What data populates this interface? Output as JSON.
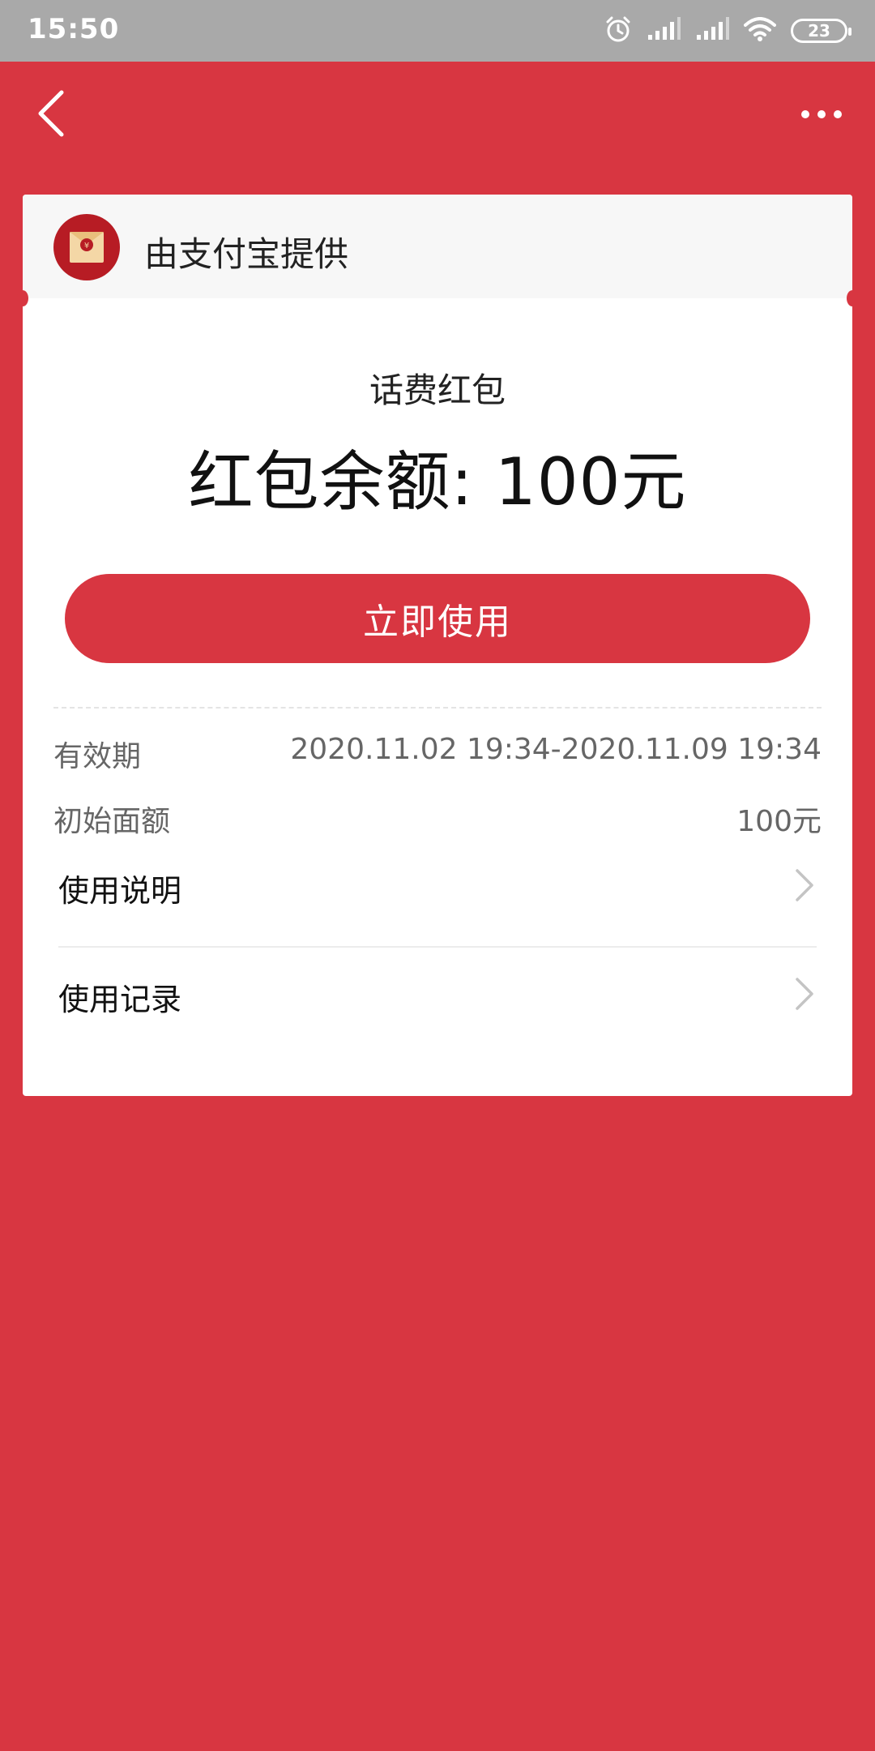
{
  "status_bar": {
    "time": "15:50",
    "battery": "23",
    "icons": [
      "alarm-icon",
      "signal-icon",
      "signal-icon",
      "wifi-icon",
      "battery-icon"
    ]
  },
  "nav": {
    "back_icon": "chevron-left-icon",
    "more_icon": "more-dots-icon"
  },
  "card": {
    "provider": "由支付宝提供",
    "provider_icon": "red-envelope-icon",
    "subtitle": "话费红包",
    "balance": "红包余额: 100元",
    "use_button": "立即使用",
    "validity_label": "有效期",
    "validity_value": "2020.11.02 19:34-2020.11.09 19:34",
    "initial_label": "初始面额",
    "initial_value": "100元",
    "menu": [
      {
        "label": "使用说明",
        "icon": "chevron-right-icon"
      },
      {
        "label": "使用记录",
        "icon": "chevron-right-icon"
      }
    ]
  },
  "colors": {
    "background": "#d83641",
    "status_bar": "#a9a9a9",
    "button": "#d83641",
    "logo": "#b71c24"
  }
}
